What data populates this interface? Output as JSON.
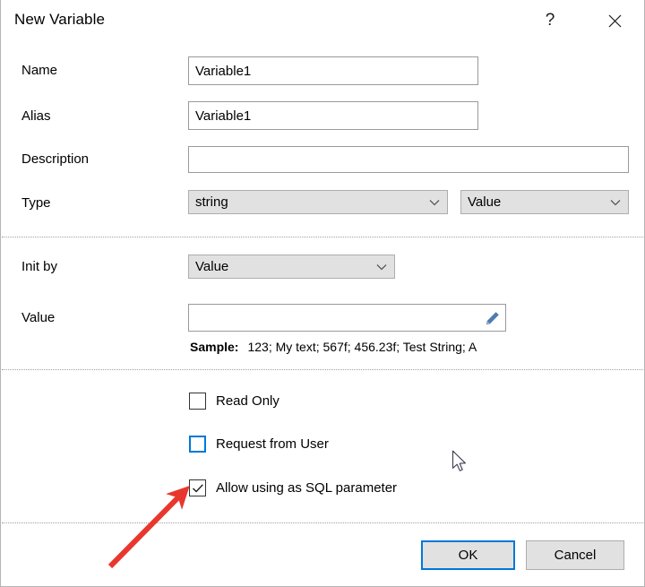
{
  "window": {
    "title": "New Variable",
    "help_icon": "question-mark-icon",
    "close_icon": "close-icon"
  },
  "form": {
    "name": {
      "label": "Name",
      "value": "Variable1",
      "placeholder": ""
    },
    "alias": {
      "label": "Alias",
      "value": "Variable1",
      "placeholder": ""
    },
    "description": {
      "label": "Description",
      "value": "",
      "placeholder": ""
    },
    "type": {
      "label": "Type",
      "data_type": "string",
      "kind": "Value"
    }
  },
  "init_section": {
    "init_by": {
      "label": "Init by",
      "value": "Value"
    },
    "value": {
      "label": "Value",
      "value": "",
      "placeholder": "",
      "edit_icon": "pencil-icon"
    },
    "sample": {
      "label": "Sample:",
      "text": "123; My text; 567f; 456.23f; Test String; A"
    }
  },
  "options": [
    {
      "label": "Read Only",
      "checked": false,
      "focused": false
    },
    {
      "label": "Request from User",
      "checked": false,
      "focused": true
    },
    {
      "label": "Allow using as SQL parameter",
      "checked": true,
      "focused": false
    }
  ],
  "footer": {
    "ok_label": "OK",
    "cancel_label": "Cancel"
  },
  "colors": {
    "accent": "#0078d7",
    "annotation": "#e8382e",
    "control_face": "#e1e1e1",
    "border": "#9a9a9a"
  }
}
